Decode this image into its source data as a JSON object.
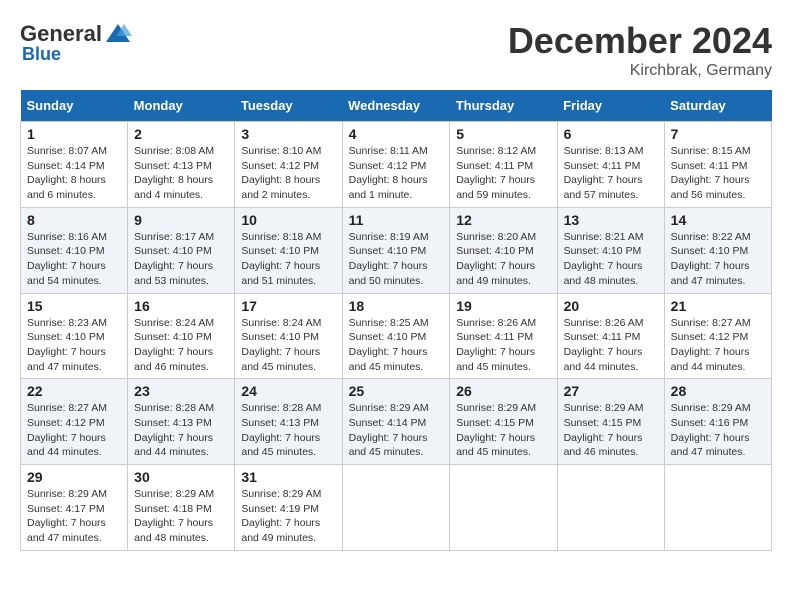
{
  "header": {
    "logo_general": "General",
    "logo_blue": "Blue",
    "month_title": "December 2024",
    "location": "Kirchbrak, Germany"
  },
  "days_of_week": [
    "Sunday",
    "Monday",
    "Tuesday",
    "Wednesday",
    "Thursday",
    "Friday",
    "Saturday"
  ],
  "weeks": [
    [
      {
        "day": "1",
        "sunrise": "8:07 AM",
        "sunset": "4:14 PM",
        "daylight": "8 hours and 6 minutes."
      },
      {
        "day": "2",
        "sunrise": "8:08 AM",
        "sunset": "4:13 PM",
        "daylight": "8 hours and 4 minutes."
      },
      {
        "day": "3",
        "sunrise": "8:10 AM",
        "sunset": "4:12 PM",
        "daylight": "8 hours and 2 minutes."
      },
      {
        "day": "4",
        "sunrise": "8:11 AM",
        "sunset": "4:12 PM",
        "daylight": "8 hours and 1 minute."
      },
      {
        "day": "5",
        "sunrise": "8:12 AM",
        "sunset": "4:11 PM",
        "daylight": "7 hours and 59 minutes."
      },
      {
        "day": "6",
        "sunrise": "8:13 AM",
        "sunset": "4:11 PM",
        "daylight": "7 hours and 57 minutes."
      },
      {
        "day": "7",
        "sunrise": "8:15 AM",
        "sunset": "4:11 PM",
        "daylight": "7 hours and 56 minutes."
      }
    ],
    [
      {
        "day": "8",
        "sunrise": "8:16 AM",
        "sunset": "4:10 PM",
        "daylight": "7 hours and 54 minutes."
      },
      {
        "day": "9",
        "sunrise": "8:17 AM",
        "sunset": "4:10 PM",
        "daylight": "7 hours and 53 minutes."
      },
      {
        "day": "10",
        "sunrise": "8:18 AM",
        "sunset": "4:10 PM",
        "daylight": "7 hours and 51 minutes."
      },
      {
        "day": "11",
        "sunrise": "8:19 AM",
        "sunset": "4:10 PM",
        "daylight": "7 hours and 50 minutes."
      },
      {
        "day": "12",
        "sunrise": "8:20 AM",
        "sunset": "4:10 PM",
        "daylight": "7 hours and 49 minutes."
      },
      {
        "day": "13",
        "sunrise": "8:21 AM",
        "sunset": "4:10 PM",
        "daylight": "7 hours and 48 minutes."
      },
      {
        "day": "14",
        "sunrise": "8:22 AM",
        "sunset": "4:10 PM",
        "daylight": "7 hours and 47 minutes."
      }
    ],
    [
      {
        "day": "15",
        "sunrise": "8:23 AM",
        "sunset": "4:10 PM",
        "daylight": "7 hours and 47 minutes."
      },
      {
        "day": "16",
        "sunrise": "8:24 AM",
        "sunset": "4:10 PM",
        "daylight": "7 hours and 46 minutes."
      },
      {
        "day": "17",
        "sunrise": "8:24 AM",
        "sunset": "4:10 PM",
        "daylight": "7 hours and 45 minutes."
      },
      {
        "day": "18",
        "sunrise": "8:25 AM",
        "sunset": "4:10 PM",
        "daylight": "7 hours and 45 minutes."
      },
      {
        "day": "19",
        "sunrise": "8:26 AM",
        "sunset": "4:11 PM",
        "daylight": "7 hours and 45 minutes."
      },
      {
        "day": "20",
        "sunrise": "8:26 AM",
        "sunset": "4:11 PM",
        "daylight": "7 hours and 44 minutes."
      },
      {
        "day": "21",
        "sunrise": "8:27 AM",
        "sunset": "4:12 PM",
        "daylight": "7 hours and 44 minutes."
      }
    ],
    [
      {
        "day": "22",
        "sunrise": "8:27 AM",
        "sunset": "4:12 PM",
        "daylight": "7 hours and 44 minutes."
      },
      {
        "day": "23",
        "sunrise": "8:28 AM",
        "sunset": "4:13 PM",
        "daylight": "7 hours and 44 minutes."
      },
      {
        "day": "24",
        "sunrise": "8:28 AM",
        "sunset": "4:13 PM",
        "daylight": "7 hours and 45 minutes."
      },
      {
        "day": "25",
        "sunrise": "8:29 AM",
        "sunset": "4:14 PM",
        "daylight": "7 hours and 45 minutes."
      },
      {
        "day": "26",
        "sunrise": "8:29 AM",
        "sunset": "4:15 PM",
        "daylight": "7 hours and 45 minutes."
      },
      {
        "day": "27",
        "sunrise": "8:29 AM",
        "sunset": "4:15 PM",
        "daylight": "7 hours and 46 minutes."
      },
      {
        "day": "28",
        "sunrise": "8:29 AM",
        "sunset": "4:16 PM",
        "daylight": "7 hours and 47 minutes."
      }
    ],
    [
      {
        "day": "29",
        "sunrise": "8:29 AM",
        "sunset": "4:17 PM",
        "daylight": "7 hours and 47 minutes."
      },
      {
        "day": "30",
        "sunrise": "8:29 AM",
        "sunset": "4:18 PM",
        "daylight": "7 hours and 48 minutes."
      },
      {
        "day": "31",
        "sunrise": "8:29 AM",
        "sunset": "4:19 PM",
        "daylight": "7 hours and 49 minutes."
      },
      null,
      null,
      null,
      null
    ]
  ],
  "labels": {
    "sunrise": "Sunrise:",
    "sunset": "Sunset:",
    "daylight": "Daylight:"
  }
}
